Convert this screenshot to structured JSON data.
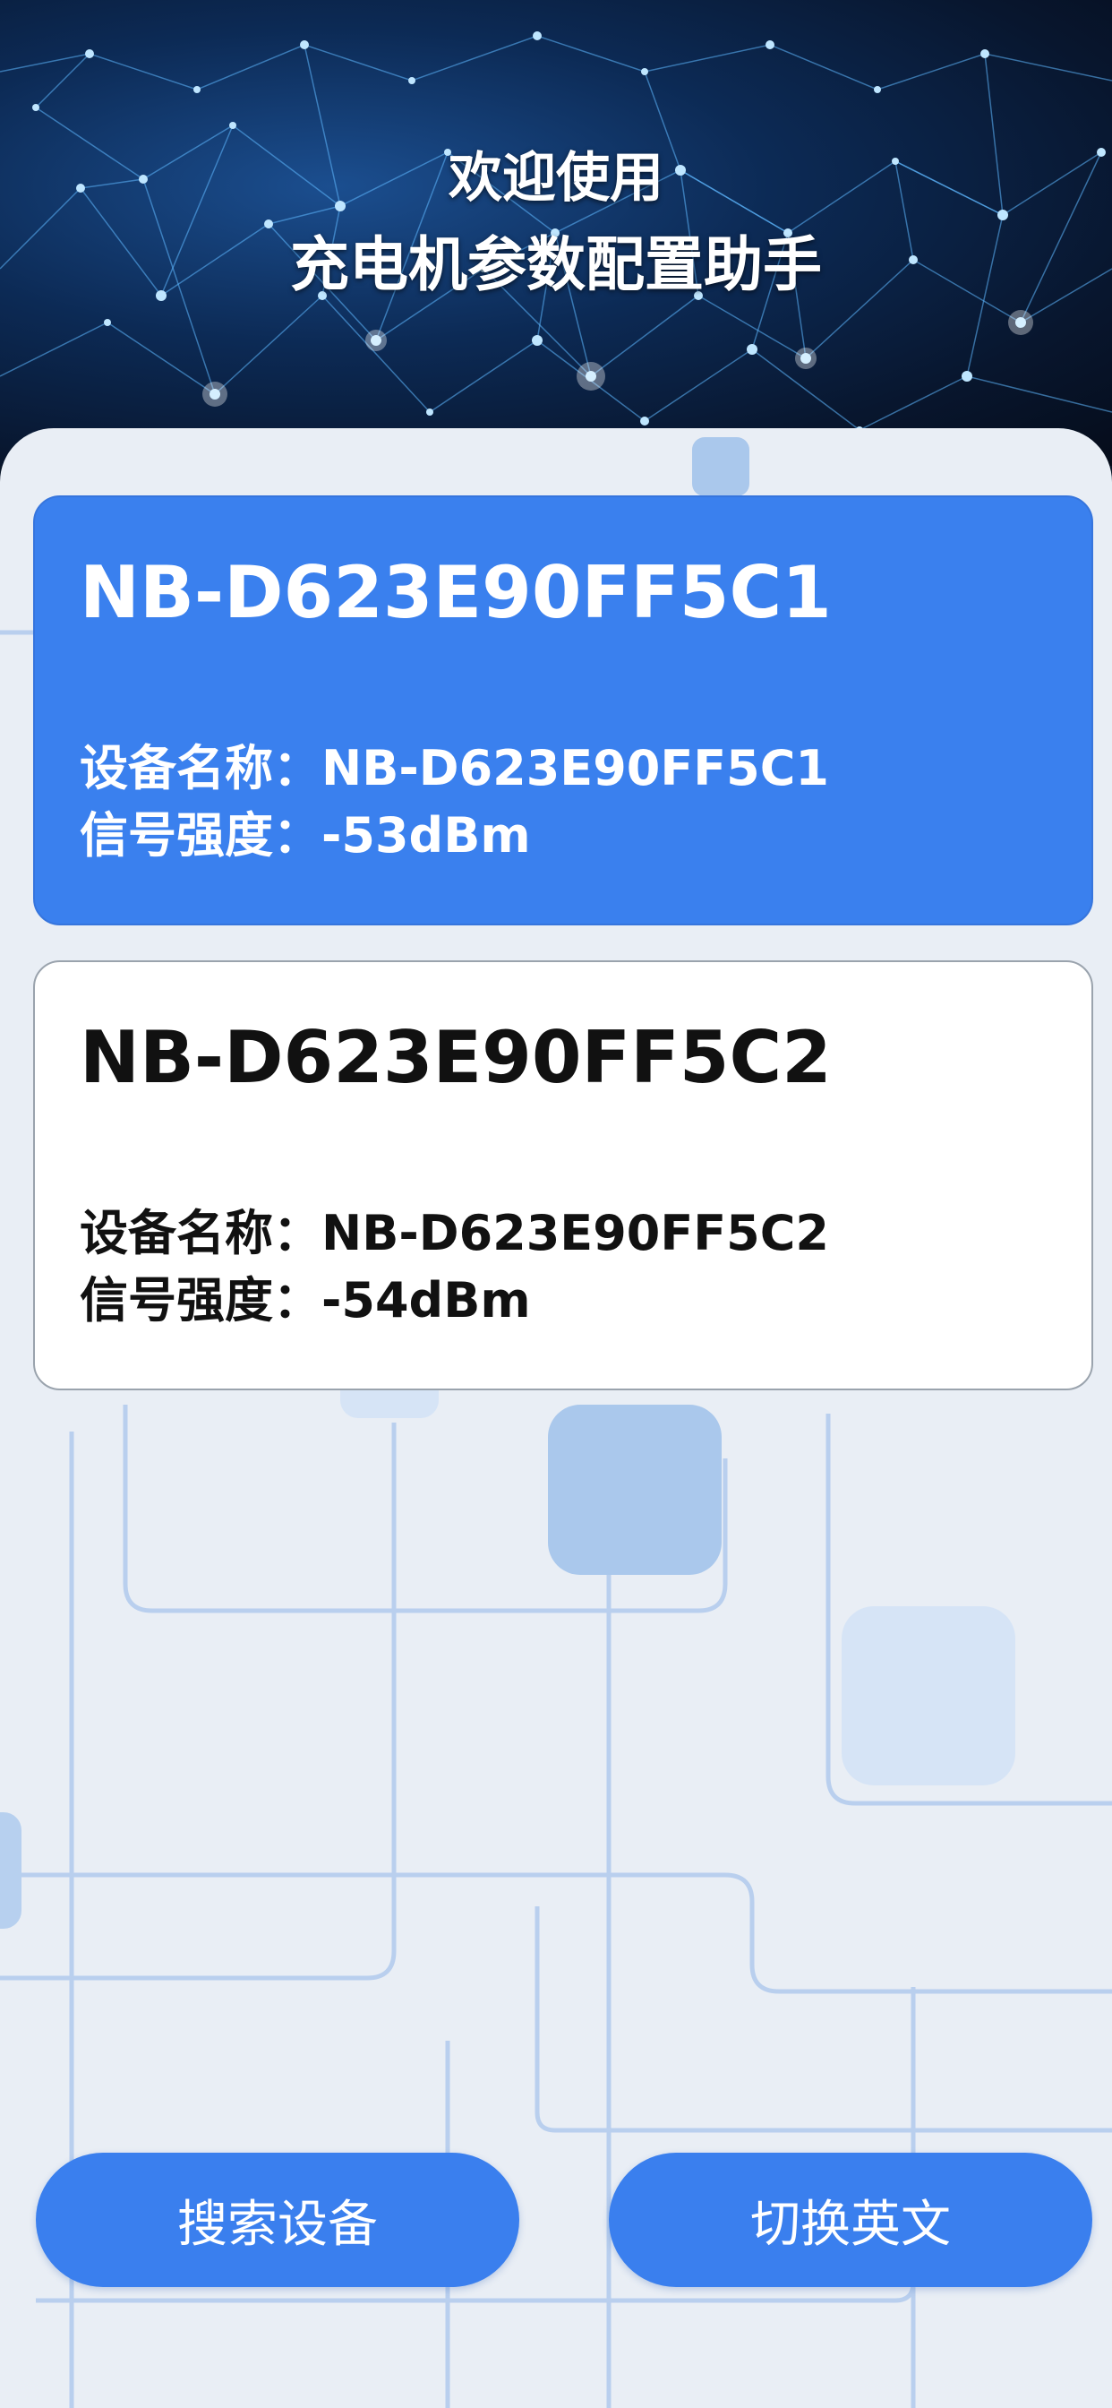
{
  "header": {
    "line1": "欢迎使用",
    "line2": "充电机参数配置助手"
  },
  "devices": [
    {
      "title": "NB-D623E90FF5C1",
      "name_label": "设备名称：",
      "name_value": "NB-D623E90FF5C1",
      "signal_label": "信号强度：",
      "signal_value": "-53dBm",
      "selected": true
    },
    {
      "title": "NB-D623E90FF5C2",
      "name_label": "设备名称：",
      "name_value": "NB-D623E90FF5C2",
      "signal_label": "信号强度：",
      "signal_value": "-54dBm",
      "selected": false
    }
  ],
  "buttons": {
    "search": "搜索设备",
    "switch_language": "切换英文"
  },
  "colors": {
    "accent": "#3a80ee",
    "panel_background": "#e9eef5",
    "card_background": "#ffffff"
  }
}
